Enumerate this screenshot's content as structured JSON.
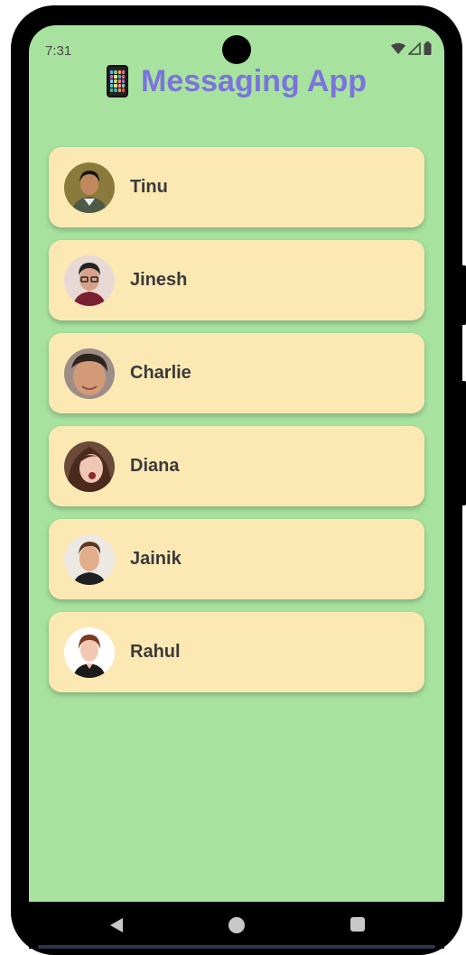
{
  "status_bar": {
    "time": "7:31"
  },
  "app": {
    "title": "Messaging App",
    "title_icon": "mobile-phone-icon"
  },
  "contacts": [
    {
      "name": "Tinu",
      "avatar": {
        "skin": "#c08a5e",
        "hair": "#1c1410",
        "shirt": "#4d5a48",
        "bg": "#8a7a3c"
      }
    },
    {
      "name": "Jinesh",
      "avatar": {
        "skin": "#d8a08a",
        "hair": "#222",
        "shirt": "#7a2030",
        "bg": "#e8d9d4"
      }
    },
    {
      "name": "Charlie",
      "avatar": {
        "skin": "#d39a78",
        "hair": "#2d2420",
        "shirt": "#333",
        "bg": "#9d8d86"
      }
    },
    {
      "name": "Diana",
      "avatar": {
        "skin": "#f0c7b4",
        "hair": "#4a2a1c",
        "shirt": "#a85a4a",
        "bg": "#6b4a3a"
      }
    },
    {
      "name": "Jainik",
      "avatar": {
        "skin": "#e1ad8a",
        "hair": "#5a3a22",
        "shirt": "#202020",
        "bg": "#ece8e2"
      }
    },
    {
      "name": "Rahul",
      "avatar": {
        "skin": "#f2c8b2",
        "hair": "#7a3a24",
        "shirt": "#1a1a1a",
        "bg": "#ffffff"
      }
    }
  ],
  "colors": {
    "screen_bg": "#a7e29e",
    "card_bg": "#fbe8b3",
    "title": "#7b74dd",
    "name_text": "#3a3a3a"
  },
  "navigation": {
    "back_icon": "back-triangle-icon",
    "home_icon": "home-circle-icon",
    "recents_icon": "recents-square-icon"
  }
}
